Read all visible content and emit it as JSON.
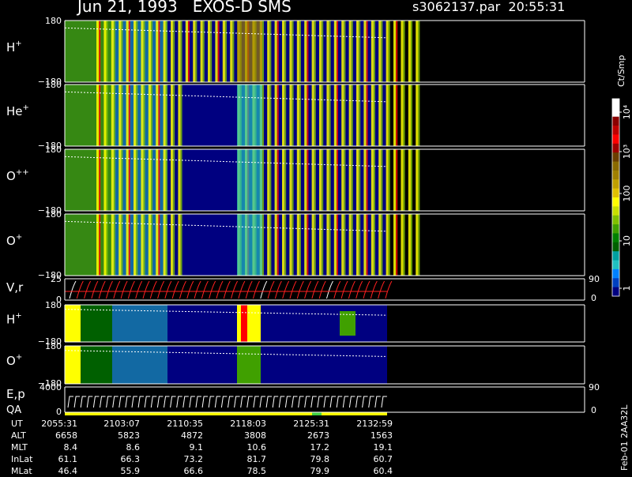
{
  "header": {
    "title": "Jun 21, 1993   EXOS-D SMS",
    "file_id": "s3062137.par  20:55:31"
  },
  "colorbar": {
    "unit": "Ct/Smp",
    "ticks": [
      "10⁴",
      "10³",
      "100",
      "10",
      "1"
    ],
    "colors": [
      "#ffffff",
      "#ffffff",
      "#8b0000",
      "#c00000",
      "#ff0000",
      "#a00000",
      "#6b3f00",
      "#8a6a00",
      "#a08000",
      "#c0a000",
      "#e0c000",
      "#ffff00",
      "#c8e000",
      "#80c000",
      "#40a000",
      "#008000",
      "#006000",
      "#00a0a0",
      "#20c0c0",
      "#0080ff",
      "#0040c0",
      "#000080"
    ]
  },
  "panels": [
    {
      "name": "H+",
      "label_main": "H",
      "label_sup": "+",
      "ymax": "180",
      "ymin": "−180"
    },
    {
      "name": "He+",
      "label_main": "He",
      "label_sup": "+",
      "ymax": "180",
      "ymin": "−180"
    },
    {
      "name": "O++",
      "label_main": "O",
      "label_sup": "++",
      "ymax": "180",
      "ymin": "−180"
    },
    {
      "name": "O+",
      "label_main": "O",
      "label_sup": "+",
      "ymax": "180",
      "ymin": "−180"
    },
    {
      "name": "V,r",
      "label_main": "V,r",
      "label_sup": "",
      "ymax": "25",
      "ymin": "0",
      "right_max": "90",
      "right_min": "0"
    },
    {
      "name": "H+ (2)",
      "label_main": "H",
      "label_sup": "+",
      "ymax": "180",
      "ymin": "−180"
    },
    {
      "name": "O+ (2)",
      "label_main": "O",
      "label_sup": "+",
      "ymax": "180",
      "ymin": "−180"
    },
    {
      "name": "E,p QA",
      "label_main": "E,p",
      "label_sup": "",
      "label_second": "QA",
      "ymax": "4000",
      "ymin": "0",
      "right_max": "90",
      "right_min": "0"
    }
  ],
  "footer": {
    "rows": [
      {
        "label": "UT",
        "values": [
          "2055:31",
          "2103:07",
          "2110:35",
          "2118:03",
          "2125:31",
          "2132:59"
        ]
      },
      {
        "label": "ALT",
        "values": [
          "6658",
          "5823",
          "4872",
          "3808",
          "2673",
          "1563"
        ]
      },
      {
        "label": "MLT",
        "values": [
          "8.4",
          "8.6",
          "9.1",
          "10.6",
          "17.2",
          "19.1"
        ]
      },
      {
        "label": "InLat",
        "values": [
          "61.1",
          "66.3",
          "73.2",
          "81.7",
          "79.8",
          "60.7"
        ]
      },
      {
        "label": "MLat",
        "values": [
          "46.4",
          "55.9",
          "66.6",
          "78.5",
          "79.9",
          "60.4"
        ]
      }
    ]
  },
  "stamp": "Feb-01 2AA32L",
  "chart_data": {
    "type": "heatmap",
    "title": "Jun 21, 1993   EXOS-D SMS",
    "x_label": "UT",
    "x_ticks": [
      "2055:31",
      "2103:07",
      "2110:35",
      "2118:03",
      "2125:31",
      "2132:59"
    ],
    "panels": [
      "H+",
      "He+",
      "O++",
      "O+",
      "V,r",
      "H+",
      "O+",
      "E,p QA"
    ],
    "angle_range": [
      -180,
      180
    ],
    "colorbar_unit": "Ct/Smp",
    "colorbar_ticks": [
      "1",
      "10",
      "100",
      "10^3",
      "10^4"
    ]
  }
}
